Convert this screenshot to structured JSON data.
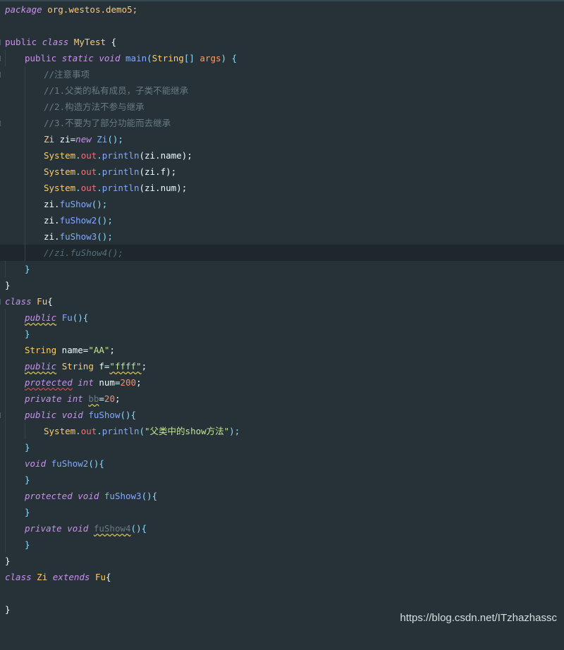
{
  "editor": {
    "theme_background": "#263238",
    "current_line_background": "#1e272c",
    "lines": {
      "l1": [
        "package",
        " org.westos.demo5;"
      ],
      "l3": [
        "public",
        " ",
        "class",
        " ",
        "MyTest",
        " {"
      ],
      "l4": [
        "public",
        " ",
        "static",
        " ",
        "void",
        " ",
        "main",
        "(",
        "String",
        "[] ",
        "args",
        ") {"
      ],
      "l5": "//注意事项",
      "l6": "//1.父类的私有成员，子类不能继承",
      "l7": "//2.构造方法不参与继承",
      "l8": "//3.不要为了部分功能而去继承",
      "l9": [
        "Zi",
        " zi=",
        "new",
        " ",
        "Zi",
        "();"
      ],
      "l10": [
        "System",
        ".",
        "out",
        ".",
        "println",
        "(zi.name);"
      ],
      "l11": [
        "System",
        ".",
        "out",
        ".",
        "println",
        "(zi.f);"
      ],
      "l12": [
        "System",
        ".",
        "out",
        ".",
        "println",
        "(zi.num);"
      ],
      "l13": [
        "zi.",
        "fuShow",
        "();"
      ],
      "l14": [
        "zi.",
        "fuShow2",
        "();"
      ],
      "l15": [
        "zi.",
        "fuShow3",
        "();"
      ],
      "l16": "//zi.fuShow4();",
      "l17": "}",
      "l18": "}",
      "l19": [
        "class",
        " ",
        "Fu",
        "{"
      ],
      "l20": [
        "public",
        " ",
        "Fu",
        "(){"
      ],
      "l21": "}",
      "l22": [
        "String",
        " name=",
        "\"AA\"",
        ";"
      ],
      "l23": [
        "public",
        " ",
        "String",
        " f=",
        "\"ffff\"",
        ";"
      ],
      "l24": [
        "protected",
        " ",
        "int",
        " num=",
        "200",
        ";"
      ],
      "l25": [
        "private",
        " ",
        "int",
        " ",
        "bb",
        "=",
        "20",
        ";"
      ],
      "l26": [
        "public",
        " ",
        "void",
        " ",
        "fuShow",
        "(){"
      ],
      "l27": [
        "System",
        ".",
        "out",
        ".",
        "println",
        "(",
        "\"父类中的show方法\"",
        ");"
      ],
      "l28": "}",
      "l29": [
        "void",
        " ",
        "fuShow2",
        "(){"
      ],
      "l30": "}",
      "l31": [
        "protected",
        " ",
        "void",
        " ",
        "fuShow3",
        "(){"
      ],
      "l32": "}",
      "l33": [
        "private",
        " ",
        "void",
        " ",
        "fuShow4",
        "(){"
      ],
      "l34": "}",
      "l35": "}",
      "l36": [
        "class",
        " ",
        "Zi",
        " ",
        "extends",
        " ",
        "Fu",
        "{"
      ],
      "l38": "}"
    }
  },
  "watermark": {
    "text": "https://blog.csdn.net/ITzhazhassc"
  }
}
